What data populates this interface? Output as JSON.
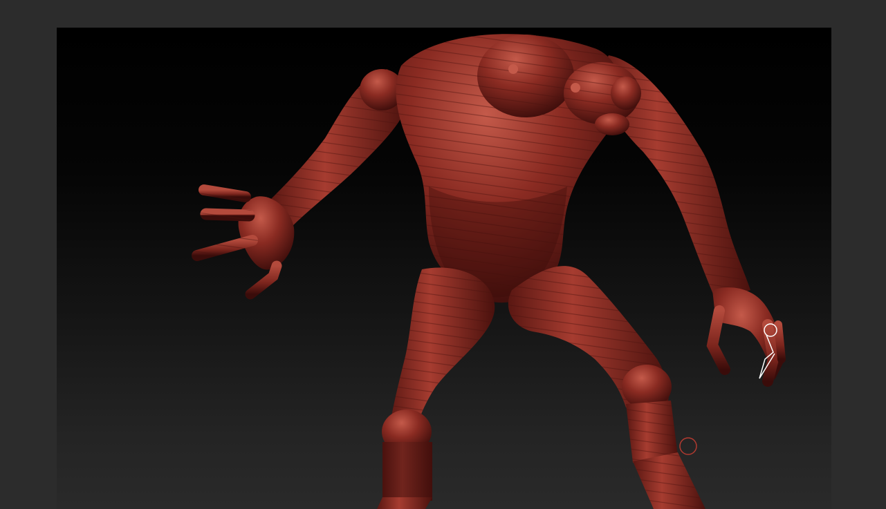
{
  "app": {
    "name": "",
    "viewport_label": ""
  },
  "viewport": {
    "background_top": "#000000",
    "background_bottom": "#2a2a2a",
    "frame_color": "#2c2c2c"
  },
  "model": {
    "material_color": "#8a2b22",
    "highlight_color": "#c45a4a",
    "shadow_color": "#3a0c0a",
    "description_parts": [
      "head",
      "torso",
      "left-arm",
      "right-arm",
      "left-leg",
      "right-leg",
      "left-hand",
      "right-hand"
    ]
  },
  "cursor": {
    "brush_ring_color": "#b23a30"
  },
  "transpose_tool": {
    "color": "#ffffff"
  }
}
